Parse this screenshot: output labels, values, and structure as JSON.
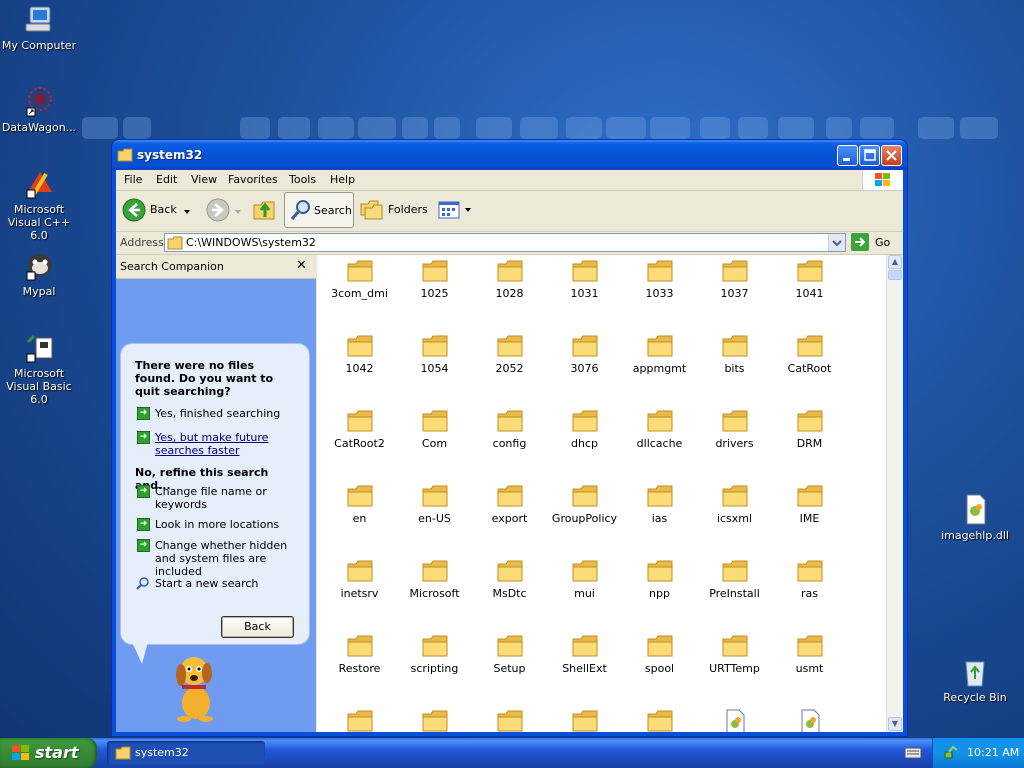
{
  "desktop": {
    "icons": [
      {
        "label": "My Computer"
      },
      {
        "label": "DataWagon..."
      },
      {
        "label": "Microsoft Visual C++ 6.0"
      },
      {
        "label": "Mypal"
      },
      {
        "label": "Microsoft Visual Basic 6.0"
      },
      {
        "label": "imagehlp.dll"
      },
      {
        "label": "Recycle Bin"
      }
    ]
  },
  "window": {
    "title": "system32",
    "menu": [
      "File",
      "Edit",
      "View",
      "Favorites",
      "Tools",
      "Help"
    ],
    "toolbar": {
      "back": "Back",
      "search": "Search",
      "folders": "Folders"
    },
    "address": {
      "label": "Address",
      "value": "C:\\WINDOWS\\system32",
      "go": "Go"
    }
  },
  "search_companion": {
    "title": "Search Companion",
    "heading": "There were no files found. Do you want to quit searching?",
    "yes_finished": "Yes, finished searching",
    "yes_faster": "Yes, but make future searches faster",
    "refine_heading": "No, refine this search and...",
    "change_name": "Change file name or keywords",
    "more_locations": "Look in more locations",
    "hidden_files": "Change whether hidden and system files are included",
    "new_search": "Start a new search",
    "back_button": "Back"
  },
  "files": [
    "3com_dmi",
    "1025",
    "1028",
    "1031",
    "1033",
    "1037",
    "1041",
    "1042",
    "1054",
    "2052",
    "3076",
    "appmgmt",
    "bits",
    "CatRoot",
    "CatRoot2",
    "Com",
    "config",
    "dhcp",
    "dllcache",
    "drivers",
    "DRM",
    "en",
    "en-US",
    "export",
    "GroupPolicy",
    "ias",
    "icsxml",
    "IME",
    "inetsrv",
    "Microsoft",
    "MsDtc",
    "mui",
    "npp",
    "PreInstall",
    "ras",
    "Restore",
    "scripting",
    "Setup",
    "ShellExt",
    "spool",
    "URTTemp",
    "usmt"
  ],
  "taskbar": {
    "start": "start",
    "task": "system32",
    "clock": "10:21 AM"
  }
}
